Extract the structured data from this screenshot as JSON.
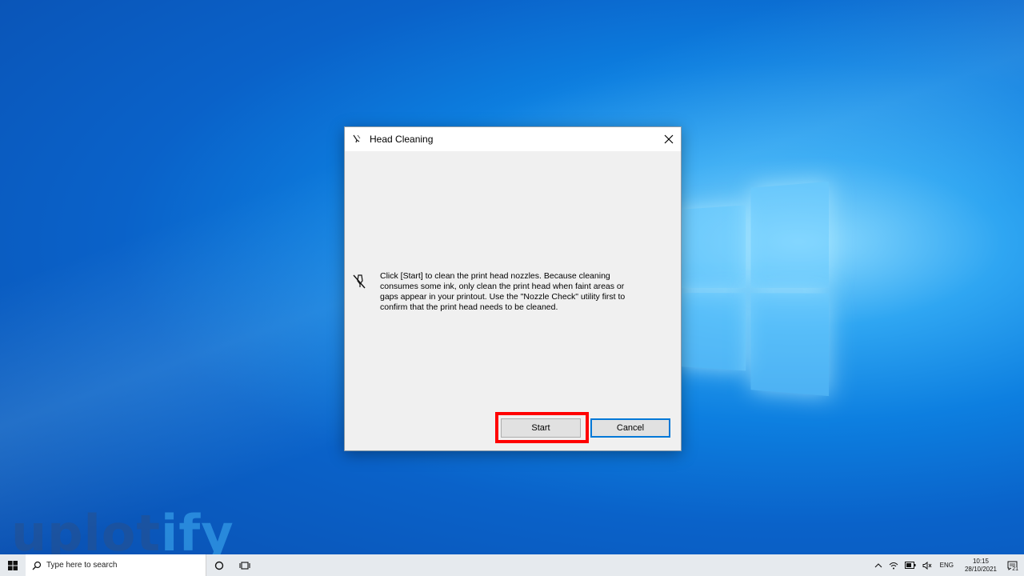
{
  "dialog": {
    "title": "Head Cleaning",
    "message": "Click [Start] to clean the print head nozzles. Because cleaning consumes some ink, only clean the print head when faint areas or gaps appear in your printout. Use the \"Nozzle Check\" utility first to confirm that the print head needs to be cleaned.",
    "start_label": "Start",
    "cancel_label": "Cancel",
    "icon": "print-head-icon"
  },
  "highlight_color": "#ff0000",
  "watermark": {
    "part1": "uplot",
    "part2": "ify"
  },
  "taskbar": {
    "search_placeholder": "Type here to search",
    "language": "ENG",
    "time": "10:15",
    "date": "28/10/2021",
    "notification_count": "21"
  }
}
